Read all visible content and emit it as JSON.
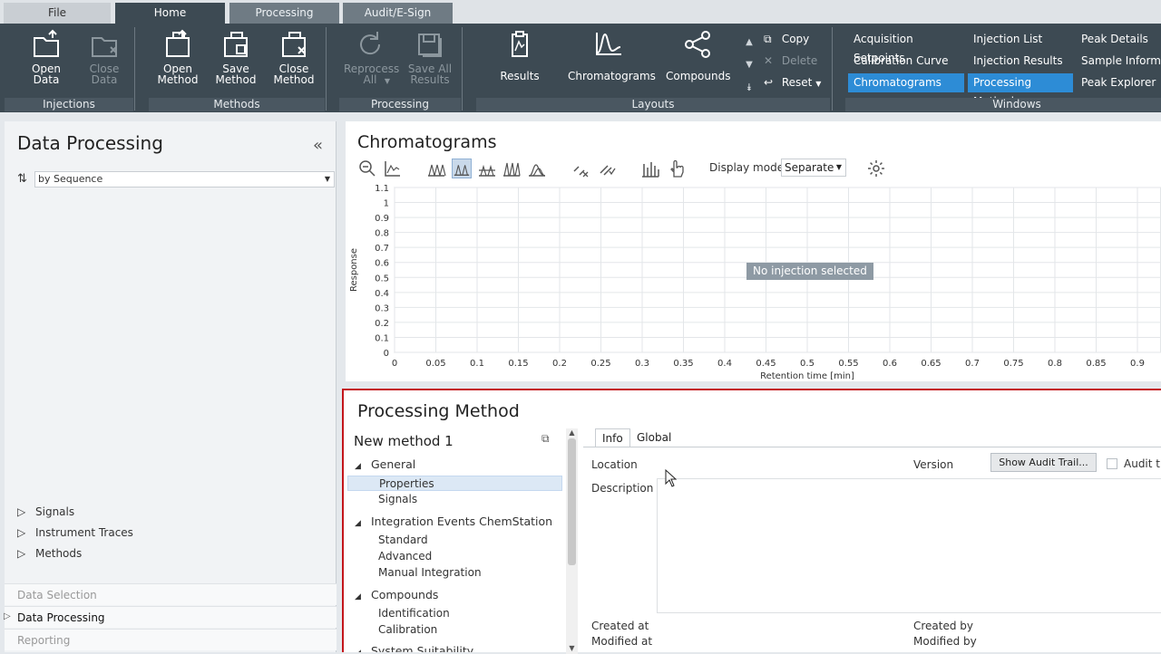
{
  "tabs": {
    "file": "File",
    "home": "Home",
    "processing": "Processing",
    "audit": "Audit/E-Sign"
  },
  "ribbon": {
    "open_data": "Open Data",
    "close_data": "Close Data",
    "open_method": "Open Method",
    "save_method": "Save Method",
    "close_method": "Close Method",
    "reprocess_all": "Reprocess All",
    "save_all_results": "Save All Results",
    "results": "Results",
    "chromatograms": "Chromatograms",
    "compounds": "Compounds",
    "copy": "Copy",
    "delete": "Delete",
    "reset": "Reset",
    "groups": {
      "injections": "Injections",
      "methods": "Methods",
      "processing": "Processing",
      "layouts": "Layouts",
      "windows": "Windows"
    },
    "windows": {
      "acquisition_setpoints": "Acquisition Setpoints",
      "injection_list": "Injection List",
      "peak_details": "Peak Details",
      "calibration_curve": "Calibration Curve",
      "injection_results": "Injection Results",
      "sample_information": "Sample Informati",
      "chromatograms": "Chromatograms",
      "processing_method": "Processing Method",
      "peak_explorer": "Peak Explorer"
    }
  },
  "left": {
    "title": "Data Processing",
    "sort_select": "by Sequence",
    "tree": [
      "Signals",
      "Instrument Traces",
      "Methods"
    ],
    "nav": [
      "Data Selection",
      "Data Processing",
      "Reporting"
    ]
  },
  "chrom": {
    "title": "Chromatograms",
    "display_mode_label": "Display mode",
    "display_mode_value": "Separate",
    "no_injection": "No injection selected"
  },
  "chart_data": {
    "type": "line",
    "series": [],
    "xlabel": "Retention time [min]",
    "ylabel": "Response",
    "xlim": [
      0,
      0.9
    ],
    "ylim": [
      0,
      1.1
    ],
    "xticks": [
      "0",
      "0.05",
      "0.1",
      "0.15",
      "0.2",
      "0.25",
      "0.3",
      "0.35",
      "0.4",
      "0.45",
      "0.5",
      "0.55",
      "0.6",
      "0.65",
      "0.7",
      "0.75",
      "0.8",
      "0.85",
      "0.9"
    ],
    "yticks": [
      "1.1",
      "1",
      "0.9",
      "0.8",
      "0.7",
      "0.6",
      "0.5",
      "0.4",
      "0.3",
      "0.2",
      "0.1",
      "0"
    ],
    "grid": true
  },
  "proc": {
    "title": "Processing Method",
    "method_name": "New method 1",
    "tree": {
      "general": "General",
      "properties": "Properties",
      "signals": "Signals",
      "integration": "Integration Events ChemStation",
      "standard": "Standard",
      "advanced": "Advanced",
      "manual": "Manual Integration",
      "compounds": "Compounds",
      "identification": "Identification",
      "calibration": "Calibration",
      "suitability": "System Suitability"
    },
    "tab_info": "Info",
    "tab_global": "Global",
    "location": "Location",
    "version": "Version",
    "show_audit": "Show Audit Trail...",
    "audit_trail": "Audit tr",
    "description": "Description",
    "created_at": "Created at",
    "modified_at": "Modified at",
    "created_by": "Created by",
    "modified_by": "Modified by"
  }
}
